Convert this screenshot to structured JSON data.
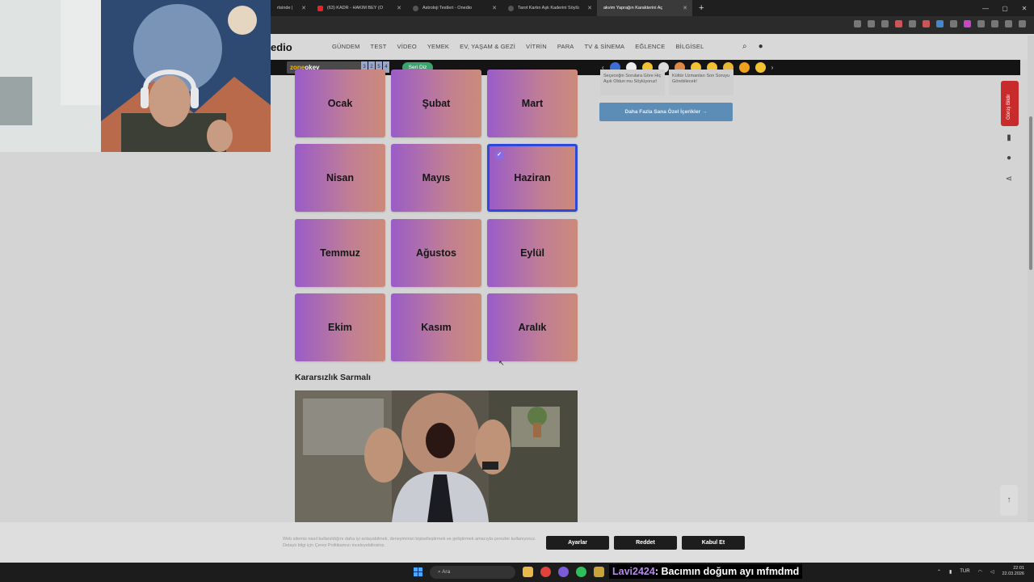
{
  "browser": {
    "tabs": [
      {
        "label": "rtsinde |",
        "active": false
      },
      {
        "label": "(63) KADR - HAKIM BEY (O",
        "active": false
      },
      {
        "label": "Astroloji Testleri - Onedio",
        "active": false
      },
      {
        "label": "Tarot Kartın Aşk Kaderini Söylü",
        "active": false
      },
      {
        "label": "akvim Yaprağın Karakterini Aç",
        "active": true
      }
    ],
    "new_tab": "+"
  },
  "site": {
    "logo": "edio",
    "nav": [
      "GÜNDEM",
      "TEST",
      "VİDEO",
      "YEMEK",
      "EV, YAŞAM & GEZİ",
      "VİTRİN",
      "PARA",
      "TV & SİNEMA",
      "EĞLENCE",
      "BİLGİSEL"
    ],
    "subbar": {
      "zone_label": "zone",
      "zone_label2": "okey",
      "numbers": [
        "3",
        "2",
        "5",
        "4"
      ],
      "seri_button": "Seri Diz"
    }
  },
  "quiz": {
    "months": [
      "Ocak",
      "Şubat",
      "Mart",
      "Nisan",
      "Mayıs",
      "Haziran",
      "Temmuz",
      "Ağustos",
      "Eylül",
      "Ekim",
      "Kasım",
      "Aralık"
    ],
    "selected": "Haziran",
    "check_glyph": "✓",
    "next_section_title": "Kararsızlık Sarmalı"
  },
  "sidebar": {
    "card1_text": "Seçeceğin Sorulara Göre Hiç Aşık Oldun mu Söylüyoruz!",
    "card2_text": "Kültür Uzmanları Son Soruyu Görebilecek!",
    "more_button": "Daha Fazla Sana Özel İçerikler  →",
    "feedback": "Görüş Bildir"
  },
  "cookie": {
    "text": "Web sitemiz nasıl kullanıldığını daha iyi anlayabilmek, deneyiminizi kişiselleştirmek ve geliştirmek amacıyla çerezler kullanıyoruz. Detaylı bilgi için Çerez Politikamızı inceleyebilirsiniz.",
    "settings_button": "Ayarlar",
    "reject_button": "Reddet",
    "accept_button": "Kabul Et"
  },
  "taskbar": {
    "search_placeholder": "Ara",
    "lang": "TUR",
    "time": "22:01",
    "date": "22.03.2026"
  },
  "chat": {
    "username": "Lavi2424",
    "message": ": Bacımın doğum ayı mfmdmd"
  }
}
